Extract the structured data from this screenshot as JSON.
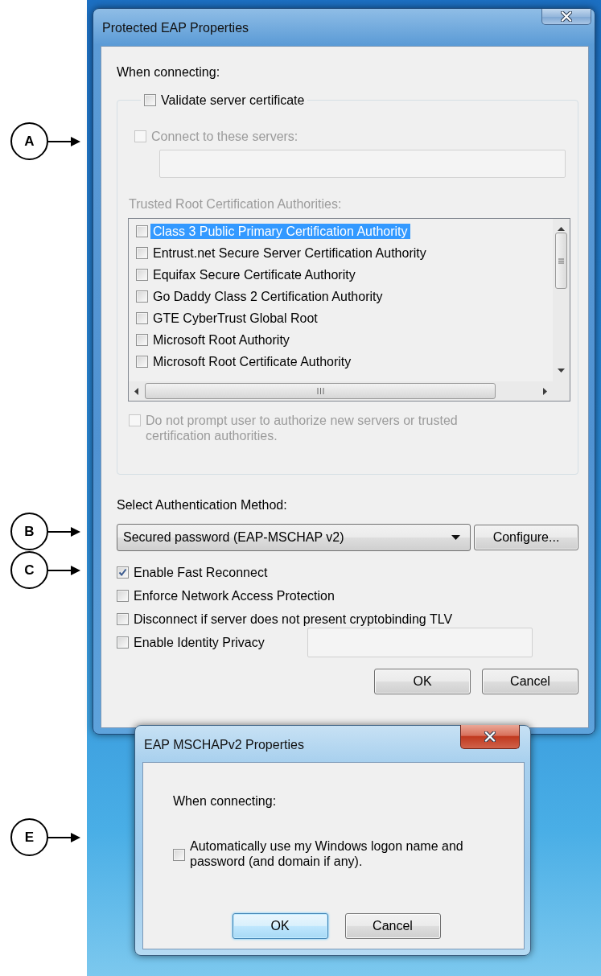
{
  "callouts": [
    {
      "label": "A"
    },
    {
      "label": "B"
    },
    {
      "label": "C"
    },
    {
      "label": "E"
    }
  ],
  "peap_dialog": {
    "title": "Protected EAP Properties",
    "active": false,
    "when_connecting": "When connecting:",
    "validate_server_certificate": {
      "label": "Validate server certificate",
      "checked": false,
      "disabled": false
    },
    "connect_to_servers": {
      "label": "Connect to these servers:",
      "checked": false,
      "disabled": true
    },
    "servers_field": {
      "disabled": true
    },
    "trusted_root_label": {
      "text": "Trusted Root Certification Authorities:",
      "disabled": true
    },
    "authorities": [
      {
        "label": "Class 3 Public Primary Certification Authority",
        "checked": false,
        "selected": true
      },
      {
        "label": "Entrust.net Secure Server Certification Authority",
        "checked": false,
        "selected": false
      },
      {
        "label": "Equifax Secure Certificate Authority",
        "checked": false,
        "selected": false
      },
      {
        "label": "Go Daddy Class 2 Certification Authority",
        "checked": false,
        "selected": false
      },
      {
        "label": "GTE CyberTrust Global Root",
        "checked": false,
        "selected": false
      },
      {
        "label": "Microsoft Root Authority",
        "checked": false,
        "selected": false
      },
      {
        "label": "Microsoft Root Certificate Authority",
        "checked": false,
        "selected": false
      }
    ],
    "do_not_prompt": {
      "label": "Do not prompt user to authorize new servers or trusted certification authorities.",
      "checked": false,
      "disabled": true
    },
    "auth_method_label": "Select Authentication Method:",
    "auth_method": {
      "value": "Secured password (EAP-MSCHAP v2)"
    },
    "configure_button": "Configure...",
    "options": [
      {
        "label": "Enable Fast Reconnect",
        "checked": true,
        "disabled": false
      },
      {
        "label": "Enforce Network Access Protection",
        "checked": false,
        "disabled": false
      },
      {
        "label": "Disconnect if server does not present cryptobinding TLV",
        "checked": false,
        "disabled": false
      },
      {
        "label": "Enable Identity Privacy",
        "checked": false,
        "disabled": false,
        "field": {
          "disabled": true
        }
      }
    ],
    "buttons": [
      {
        "label": "OK",
        "default": false
      },
      {
        "label": "Cancel",
        "default": false
      }
    ]
  },
  "mschap_dialog": {
    "title": "EAP MSCHAPv2 Properties",
    "active": true,
    "when_connecting": "When connecting:",
    "auto_logon": {
      "label": "Automatically use my Windows logon name and password (and domain if any).",
      "checked": false,
      "disabled": false
    },
    "buttons": [
      {
        "label": "OK",
        "default": true
      },
      {
        "label": "Cancel",
        "default": false
      }
    ]
  }
}
